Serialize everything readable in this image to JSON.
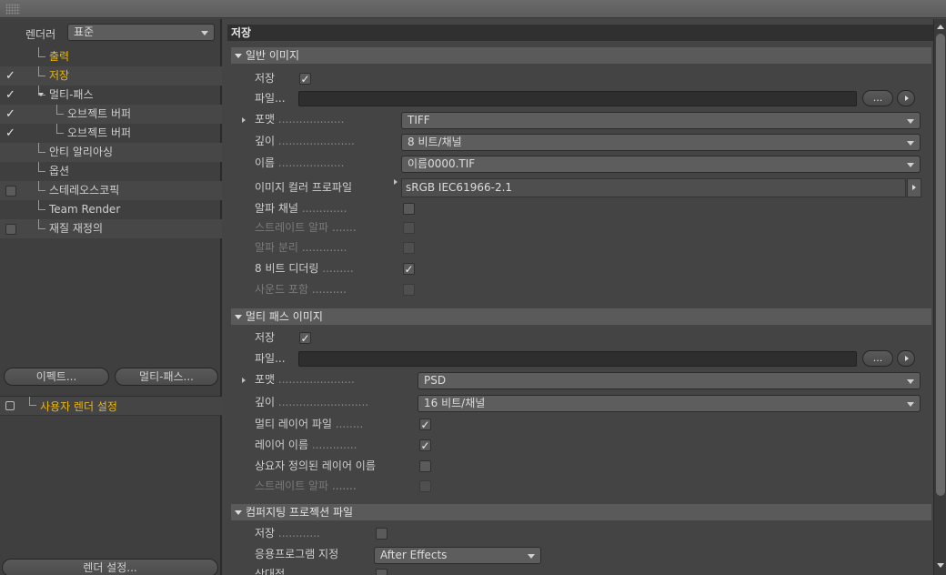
{
  "left": {
    "renderer_label": "렌더러",
    "renderer_value": "표준",
    "tree": [
      {
        "label": "출력",
        "check": "none",
        "active": false
      },
      {
        "label": "저장",
        "check": "tick",
        "active": true
      },
      {
        "label": "멀티-패스",
        "check": "tick",
        "active": false
      },
      {
        "label": "오브젝트 버퍼",
        "check": "tick",
        "active": false
      },
      {
        "label": "오브젝트 버퍼",
        "check": "tick",
        "active": false
      },
      {
        "label": "안티 알리아싱",
        "check": "none",
        "active": false
      },
      {
        "label": "옵션",
        "check": "none",
        "active": false
      },
      {
        "label": "스테레오스코픽",
        "check": "box",
        "active": false
      },
      {
        "label": "Team Render",
        "check": "none",
        "active": false
      },
      {
        "label": "재질 재정의",
        "check": "box",
        "active": false
      }
    ],
    "effect_button": "이펙트...",
    "multipass_button": "멀티-패스...",
    "user_settings": "사용자 렌더 설정",
    "render_settings_button": "렌더 설정..."
  },
  "right": {
    "title": "저장",
    "regular": {
      "header": "일반 이미지",
      "save_label": "저장",
      "file_label": "파일...",
      "file_button": "...",
      "format_label": "포맷",
      "format_value": "TIFF",
      "depth_label": "깊이",
      "depth_value": "8 비트/채널",
      "name_label": "이름",
      "name_value": "이름0000.TIF",
      "profile_label": "이미지 컬러 프로파일",
      "profile_value": "sRGB IEC61966-2.1",
      "alpha_label": "알파 채널",
      "straight_alpha_label": "스트레이트 알파",
      "separate_alpha_label": "알파 분리",
      "dither_label": "8 비트 디더링",
      "sound_label": "사운드 포함"
    },
    "multipass": {
      "header": "멀티 패스 이미지",
      "save_label": "저장",
      "file_label": "파일...",
      "file_button": "...",
      "format_label": "포맷",
      "format_value": "PSD",
      "depth_label": "깊이",
      "depth_value": "16 비트/채널",
      "layer_file_label": "멀티 레이어 파일",
      "layer_name_label": "레이어 이름",
      "user_layer_name_label": "상요자 정의된 레이어 이름",
      "straight_alpha_label": "스트레이트 알파"
    },
    "compositing": {
      "header": "컴퍼지팅 프로젝션 파일",
      "save_label": "저장",
      "app_label": "응용프로그램 지정",
      "app_value": "After Effects",
      "relative_label": "상대적"
    }
  }
}
